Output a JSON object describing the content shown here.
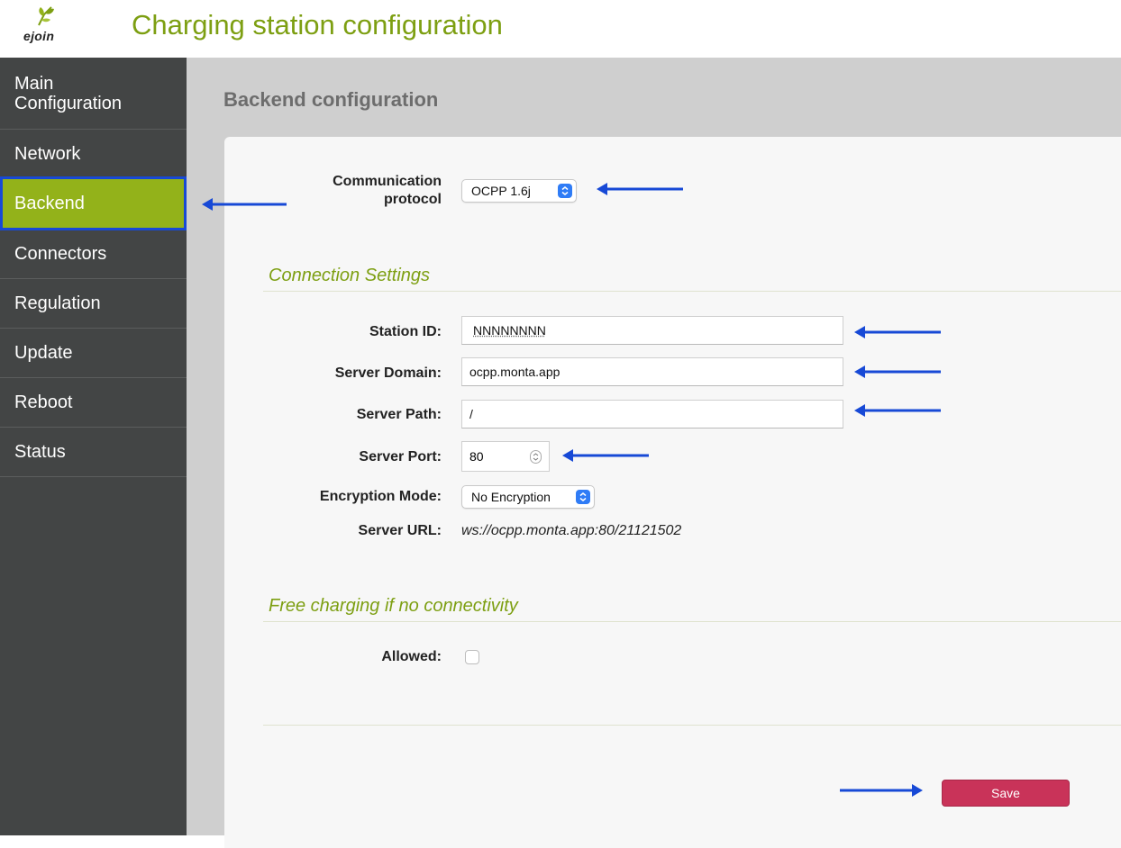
{
  "header": {
    "logo_text": "ejoin",
    "title": "Charging station configuration"
  },
  "sidebar": {
    "items": [
      {
        "label": "Main Configuration"
      },
      {
        "label": "Network"
      },
      {
        "label": "Backend"
      },
      {
        "label": "Connectors"
      },
      {
        "label": "Regulation"
      },
      {
        "label": "Update"
      },
      {
        "label": "Reboot"
      },
      {
        "label": "Status"
      }
    ],
    "active": "Backend"
  },
  "main": {
    "page_title": "Backend configuration",
    "protocol": {
      "label_line1": "Communication",
      "label_line2": "protocol",
      "value": "OCPP 1.6j"
    },
    "connection_settings": {
      "title": "Connection Settings",
      "station_id": {
        "label": "Station ID:",
        "value": "NNNNNNNN"
      },
      "server_domain": {
        "label": "Server Domain:",
        "value": "ocpp.monta.app"
      },
      "server_path": {
        "label": "Server Path:",
        "value": "/"
      },
      "server_port": {
        "label": "Server Port:",
        "value": "80"
      },
      "encryption_mode": {
        "label": "Encryption Mode:",
        "value": "No Encryption"
      },
      "server_url": {
        "label": "Server URL:",
        "value": "ws://ocpp.monta.app:80/21121502"
      }
    },
    "free_charging": {
      "title": "Free charging if no connectivity",
      "allowed": {
        "label": "Allowed:",
        "checked": false
      }
    },
    "save_label": "Save"
  },
  "colors": {
    "accent": "#93b21a",
    "title_green": "#7d9f12",
    "sidebar_bg": "#434545",
    "save_button": "#c93359",
    "annotation_arrow": "#1749d6"
  }
}
